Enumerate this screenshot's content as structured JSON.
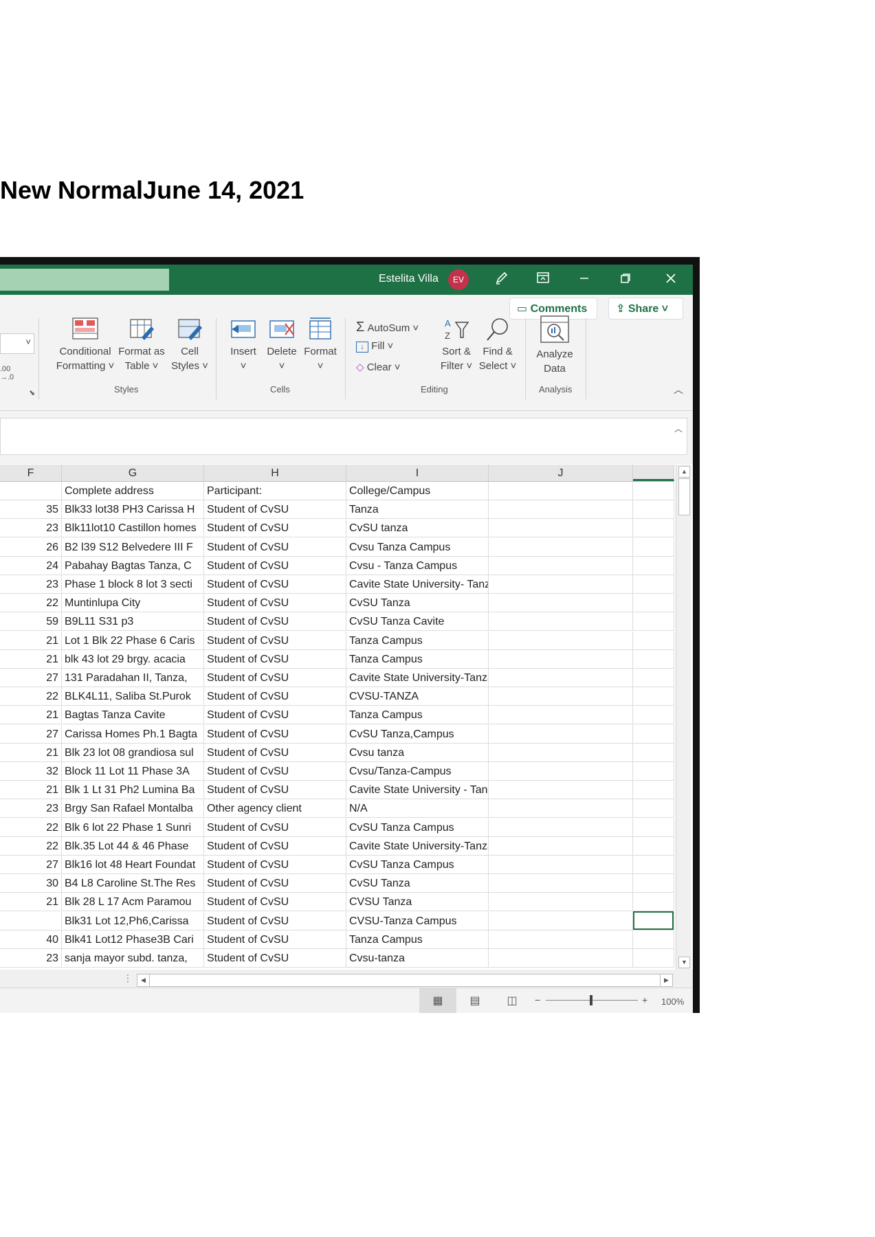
{
  "document": {
    "heading": "New NormalJune 14, 2021"
  },
  "titlebar": {
    "user_name": "Estelita Villa",
    "avatar_initials": "EV"
  },
  "ribbon": {
    "comments": "Comments",
    "share": "Share",
    "number_decrease": ".00\n→.0",
    "conditional_formatting": "Conditional\nFormatting ˅",
    "format_as_table": "Format as\nTable ˅",
    "cell_styles": "Cell\nStyles ˅",
    "insert": "Insert",
    "delete": "Delete",
    "format": "Format",
    "autosum": "AutoSum",
    "fill": "Fill",
    "clear": "Clear",
    "sort_filter": "Sort &\nFilter ˅",
    "find_select": "Find &\nSelect ˅",
    "analyze_data": "Analyze\nData",
    "groups": {
      "styles": "Styles",
      "cells": "Cells",
      "editing": "Editing",
      "analysis": "Analysis"
    }
  },
  "columns": [
    "F",
    "G",
    "H",
    "I",
    "J"
  ],
  "table": {
    "header": [
      "",
      "Complete address",
      "Participant:",
      "College/Campus",
      ""
    ],
    "rows": [
      [
        "35",
        "Blk33 lot38 PH3 Carissa H",
        "Student of CvSU",
        "Tanza"
      ],
      [
        "23",
        "Blk11lot10 Castillon homes",
        "Student of CvSU",
        "CvSU tanza"
      ],
      [
        "26",
        "B2 l39 S12 Belvedere III F",
        "Student of CvSU",
        "Cvsu Tanza Campus"
      ],
      [
        "24",
        "Pabahay Bagtas Tanza, C",
        "Student of CvSU",
        "Cvsu - Tanza Campus"
      ],
      [
        "23",
        "Phase 1 block 8 lot 3 secti",
        "Student of CvSU",
        "Cavite State University- Tanza"
      ],
      [
        "22",
        "Muntinlupa City",
        "Student of CvSU",
        "CvSU Tanza"
      ],
      [
        "59",
        "B9L11 S31 p3",
        "Student of CvSU",
        "CvSU Tanza Cavite"
      ],
      [
        "21",
        "Lot 1 Blk 22 Phase 6 Caris",
        "Student of CvSU",
        "Tanza Campus"
      ],
      [
        "21",
        "blk 43 lot 29 brgy. acacia",
        "Student of CvSU",
        "Tanza Campus"
      ],
      [
        "27",
        "131 Paradahan II, Tanza,",
        "Student of CvSU",
        "Cavite State University-Tanza Campus"
      ],
      [
        "22",
        "BLK4L11, Saliba St.Purok",
        "Student of CvSU",
        "CVSU-TANZA"
      ],
      [
        "21",
        "Bagtas Tanza Cavite",
        "Student of CvSU",
        "Tanza Campus"
      ],
      [
        "27",
        "Carissa Homes Ph.1 Bagta",
        "Student of CvSU",
        "CvSU Tanza,Campus"
      ],
      [
        "21",
        "Blk 23 lot 08 grandiosa sul",
        "Student of CvSU",
        "Cvsu tanza"
      ],
      [
        "32",
        "Block 11 Lot 11 Phase 3A",
        "Student of CvSU",
        "Cvsu/Tanza-Campus"
      ],
      [
        "21",
        "Blk 1 Lt 31 Ph2 Lumina Ba",
        "Student of CvSU",
        "Cavite State University - Tanza Campus"
      ],
      [
        "23",
        "Brgy San Rafael Montalba",
        "Other agency client",
        "N/A"
      ],
      [
        "22",
        "Blk 6 lot 22 Phase 1 Sunri",
        "Student of CvSU",
        "CvSU Tanza Campus"
      ],
      [
        "22",
        "Blk.35 Lot 44 & 46 Phase",
        "Student of CvSU",
        "Cavite State University-Tanza Campus"
      ],
      [
        "27",
        "Blk16 lot 48 Heart Foundat",
        "Student of CvSU",
        "CvSU Tanza Campus"
      ],
      [
        "30",
        "B4 L8 Caroline St.The Res",
        "Student of CvSU",
        "CvSU Tanza"
      ],
      [
        "21",
        "Blk 28 L 17 Acm Paramou",
        "Student of CvSU",
        "CVSU Tanza"
      ],
      [
        "",
        "Blk31 Lot 12,Ph6,Carissa",
        "Student of CvSU",
        "CVSU-Tanza Campus"
      ],
      [
        "40",
        "Blk41 Lot12 Phase3B Cari",
        "Student of CvSU",
        "Tanza Campus"
      ],
      [
        "23",
        "sanja mayor subd. tanza,",
        "Student of CvSU",
        "Cvsu-tanza"
      ]
    ]
  },
  "status": {
    "zoom": "100%"
  }
}
